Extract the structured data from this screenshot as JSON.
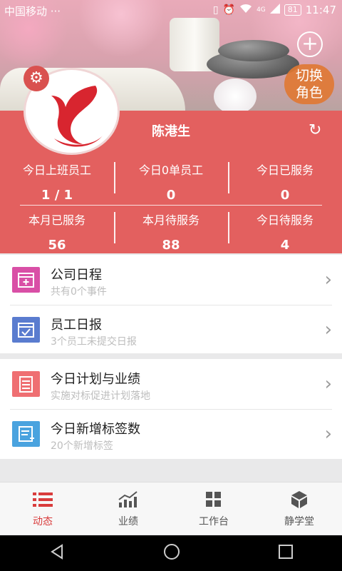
{
  "status_bar": {
    "carrier": "中国移动 ···",
    "network": "4G",
    "battery": "81",
    "time": "11:47"
  },
  "header": {
    "switch_role_line1": "切换",
    "switch_role_line2": "角色",
    "username": "陈港生"
  },
  "stats": [
    {
      "label": "今日上班员工",
      "value": "1 / 1"
    },
    {
      "label": "今日0单员工",
      "value": "0"
    },
    {
      "label": "今日已服务",
      "value": "0"
    },
    {
      "label": "本月已服务",
      "value": "56"
    },
    {
      "label": "本月待服务",
      "value": "88"
    },
    {
      "label": "今日待服务",
      "value": "4"
    }
  ],
  "menu": [
    {
      "title": "公司日程",
      "subtitle": "共有0个事件",
      "icon": "calendar-add-icon",
      "color": "#d94fa6"
    },
    {
      "title": "员工日报",
      "subtitle": "3个员工未提交日报",
      "icon": "calendar-check-icon",
      "color": "#5a7ccf"
    },
    {
      "title": "今日计划与业绩",
      "subtitle": "实施对标促进计划落地",
      "icon": "clipboard-icon",
      "color": "#ef6f72"
    },
    {
      "title": "今日新增标签数",
      "subtitle": "20个新增标签",
      "icon": "tag-note-icon",
      "color": "#4aa3df"
    }
  ],
  "tabs": [
    {
      "label": "动态",
      "icon": "list-icon",
      "active": true
    },
    {
      "label": "业绩",
      "icon": "chart-up-icon",
      "active": false
    },
    {
      "label": "工作台",
      "icon": "grid-icon",
      "active": false
    },
    {
      "label": "静学堂",
      "icon": "cube-icon",
      "active": false
    }
  ],
  "colors": {
    "accent": "#e3605f",
    "active_tab": "#d93c3c"
  }
}
